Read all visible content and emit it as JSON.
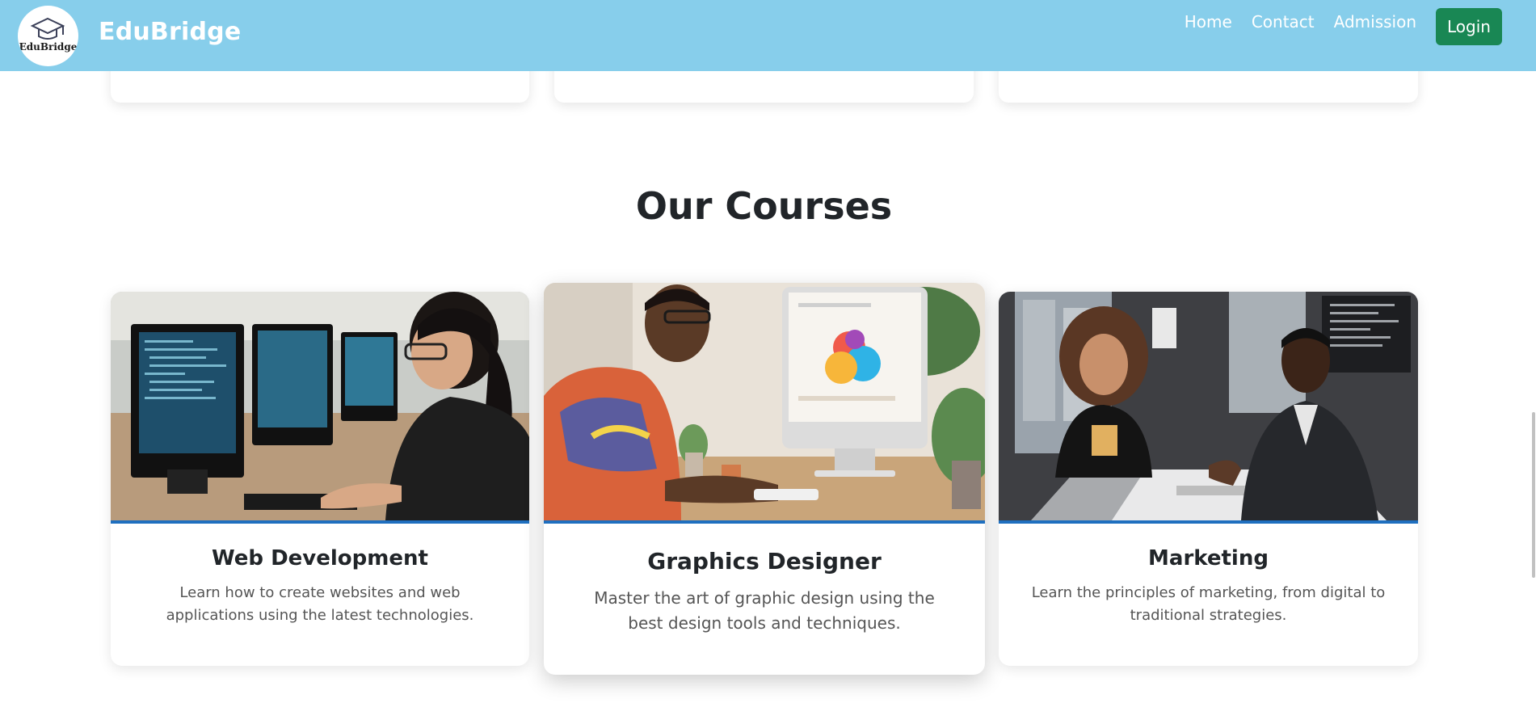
{
  "navbar": {
    "logo_text": "EduBridge",
    "brand": "EduBridge",
    "links": [
      "Home",
      "Contact",
      "Admission"
    ],
    "login_label": "Login",
    "background": "#87ceeb",
    "login_color": "#198754"
  },
  "courses": {
    "title": "Our Courses",
    "cards": [
      {
        "title": "Web Development",
        "text": "Learn how to create websites and web applications using the latest technologies."
      },
      {
        "title": "Graphics Designer",
        "text": "Master the art of graphic design using the best design tools and techniques."
      },
      {
        "title": "Marketing",
        "text": "Learn the principles of marketing, from digital to traditional strategies."
      }
    ],
    "image_border_color": "#1f6fbf"
  }
}
